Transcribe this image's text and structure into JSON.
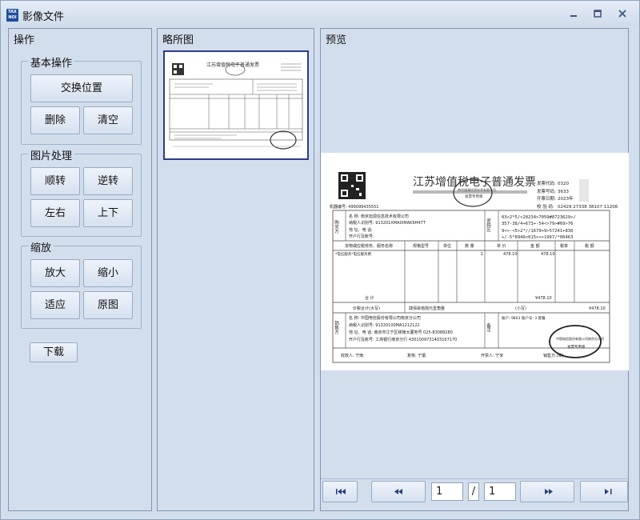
{
  "app": {
    "logo_line1": "TAX",
    "logo_line2": "NOI",
    "title": "影像文件"
  },
  "panels": {
    "ops_title": "操作",
    "thumb_title": "略所图",
    "preview_title": "预览"
  },
  "groups": {
    "basic": "基本操作",
    "image": "图片处理",
    "zoom": "缩放"
  },
  "buttons": {
    "swap": "交换位置",
    "delete": "删除",
    "clear": "清空",
    "rotate_cw": "顺转",
    "rotate_ccw": "逆转",
    "flip_h": "左右",
    "flip_v": "上下",
    "zoom_in": "放大",
    "zoom_out": "缩小",
    "fit": "适应",
    "original": "原图",
    "download": "下载"
  },
  "pager": {
    "current": "1",
    "separator": "/",
    "total": "1"
  },
  "invoice": {
    "title": "江苏增值税电子普通发票",
    "code_label": "发票代码:",
    "code_value": "0320",
    "number_label": "发票号码:",
    "number_value": "3633",
    "date_label": "开票日期:",
    "date_value": "2023年",
    "check_label": "校 验 码:",
    "check_value": "02429 27338 38107 11206",
    "machine": "机器编号: 499099435551",
    "buyer_side": "购买方",
    "buyer_name": "名 称: 南京旭源信息技术有限公司",
    "buyer_tax": "纳税人识别号: 913201XMAIXMAK9H47T",
    "buyer_addr": "地 址、电 话:",
    "buyer_bank": "开户行及账号:",
    "cipher_side": "密码区",
    "cipher_1": "03<2*5/>20234>7059#8723629>/",
    "cipher_2": "357-38/4+673+-54<>79>#69>76",
    "cipher_3": "9<>-<5>2*//1679+9>57241+830",
    "cipher_4": "+/-5*8946<015>+>1967/*06463",
    "col_name": "货物或应税劳务、服务名称",
    "col_spec": "规格型号",
    "col_unit": "单位",
    "col_qty": "数 量",
    "col_price": "单 价",
    "col_amount": "金 额",
    "col_rate": "税率",
    "col_tax": "税 额",
    "item_name": "*电信服务*电信服务费",
    "item_qty": "1",
    "item_price": "478.10",
    "item_amount": "478.10",
    "subtotal_label": "合 计",
    "subtotal_value": "¥478.10",
    "total_label": "价税合计(大写)",
    "total_words": "肆佰柒拾捌元壹角整",
    "total_small_label": "(小写)",
    "total_small_value": "¥478.10",
    "seller_side": "销售方",
    "seller_name": "名 称: 中国电信股份有限公司南京分公司",
    "seller_tax": "纳税人识别号: 91320100MA1212122",
    "seller_addr": "地 址、电 话: 南京市江宁区秣陵大厦地号 025-83088280",
    "seller_bank": "开户行及账号: 工商银行南京分行 4301009731403167170",
    "remark_side": "备注",
    "remark_text": "账户: 9803 账户号: 3 套餐",
    "payee": "收款人: 宁雨",
    "reviewer": "复核: 宁蕾",
    "issuer": "开票人: 宁米",
    "seller_seal": "销售方:(章)",
    "seal_top": "南京旭源信息技术有限公司",
    "seal_mid": "发票专用章",
    "seal2_top": "中国电信股份有限公司南京分公司",
    "seal2_mid": "发票专用章"
  }
}
